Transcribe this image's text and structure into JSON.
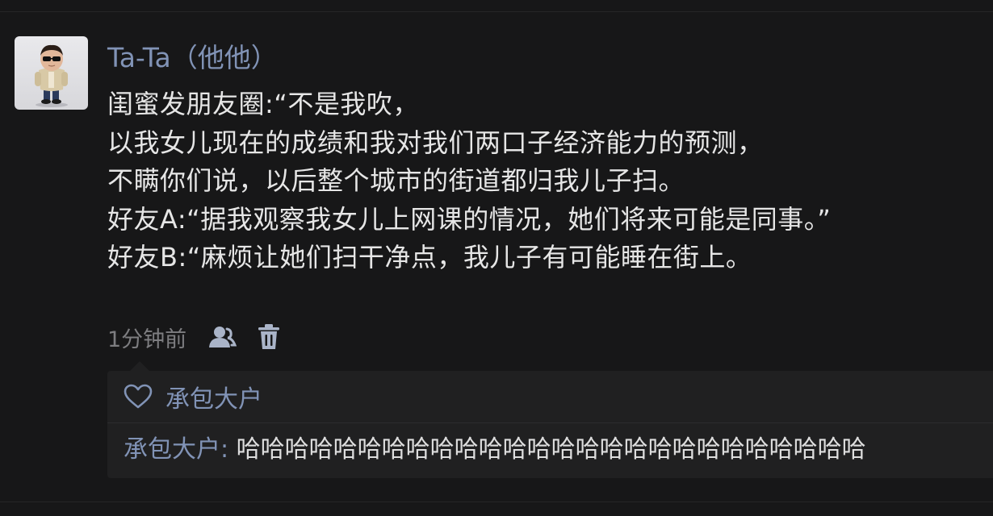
{
  "post": {
    "author": "Ta-Ta（他他）",
    "lines": [
      "闺蜜发朋友圈:“不是我吹，",
      "以我女儿现在的成绩和我对我们两口子经济能力的预测，",
      "不瞒你们说，以后整个城市的街道都归我儿子扫。",
      "好友A:“据我观察我女儿上网课的情况，她们将来可能是同事。”",
      "好友B:“麻烦让她们扫干净点，我儿子有可能睡在街上。"
    ],
    "timestamp": "1分钟前",
    "icons": {
      "visibility": "friends-visibility-icon",
      "delete": "trash-icon",
      "like": "heart-outline-icon"
    }
  },
  "interactions": {
    "likes": [
      "承包大户"
    ],
    "comments": [
      {
        "author": "承包大户",
        "separator": ": ",
        "text": "哈哈哈哈哈哈哈哈哈哈哈哈哈哈哈哈哈哈哈哈哈哈哈哈哈哈"
      }
    ]
  },
  "colors": {
    "background": "#171718",
    "name_link": "#8193b6",
    "body_text": "#e6e6e6",
    "meta_text": "#7d7d80",
    "panel": "#202021"
  }
}
